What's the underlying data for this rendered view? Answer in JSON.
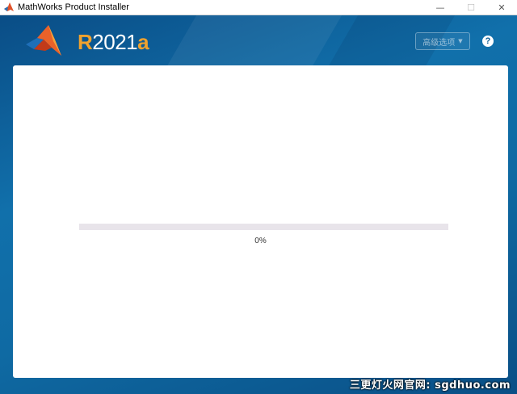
{
  "window": {
    "title": "MathWorks Product Installer",
    "minimize_glyph": "—",
    "maximize_glyph": "☐",
    "close_glyph": "✕"
  },
  "header": {
    "release_prefix": "R",
    "release_year": "2021",
    "release_suffix": "a",
    "advanced_options_label": "高级选项",
    "advanced_caret": "▼",
    "help_glyph": "?"
  },
  "installer": {
    "progress": 0,
    "progress_text": "0%"
  },
  "watermark": {
    "text": "三更灯火网官网: sgdhuo.com"
  },
  "colors": {
    "brand_orange": "#f0a22e",
    "banner_blue": "#0d5d94",
    "progress_blue": "#1a7fc4"
  }
}
